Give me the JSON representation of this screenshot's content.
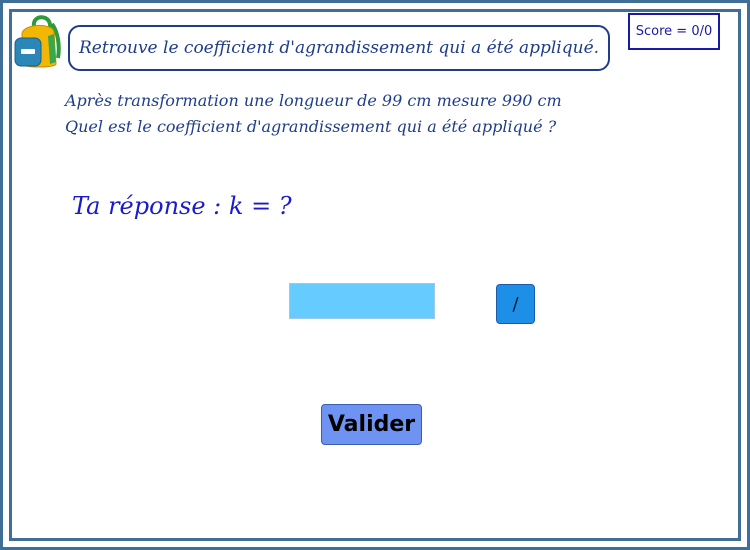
{
  "header": {
    "title": "Retrouve le coefficient d'agrandissement qui a été appliqué.",
    "score": "Score = 0/0",
    "logo_icon": "backpack-icon"
  },
  "problem": {
    "line1": "Après transformation une longueur de 99 cm mesure 990 cm",
    "line2": "Quel est le coefficient d'agrandissement qui a été appliqué ?"
  },
  "answer": {
    "label": "Ta réponse : k = ?",
    "input_value": "",
    "fraction_button_label": "/"
  },
  "actions": {
    "validate_label": "Valider"
  },
  "colors": {
    "frame": "#3f6e96",
    "title_text": "#1f3d8a",
    "answer_label": "#1a1acc",
    "input_bg": "#66ccff",
    "fraction_button_bg": "#1e8fe6",
    "validate_bg": "#6f93f2"
  }
}
